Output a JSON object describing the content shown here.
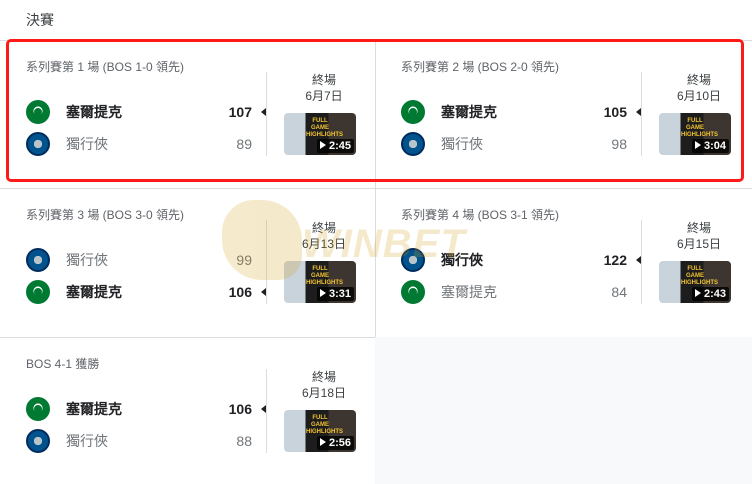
{
  "title": "決賽",
  "games": [
    {
      "header": "系列賽第 1 場 (BOS 1-0 領先)",
      "status": "終場",
      "date": "6月7日",
      "duration": "2:45",
      "thumb_banner": "FULL GAME HIGHLIGHTS",
      "teams": [
        {
          "name": "塞爾提克",
          "score": "107",
          "logo": "celtics-logo",
          "winner": true
        },
        {
          "name": "獨行俠",
          "score": "89",
          "logo": "mavericks-logo",
          "winner": false
        }
      ]
    },
    {
      "header": "系列賽第 2 場 (BOS 2-0 領先)",
      "status": "終場",
      "date": "6月10日",
      "duration": "3:04",
      "thumb_banner": "FULL GAME HIGHLIGHTS",
      "teams": [
        {
          "name": "塞爾提克",
          "score": "105",
          "logo": "celtics-logo",
          "winner": true
        },
        {
          "name": "獨行俠",
          "score": "98",
          "logo": "mavericks-logo",
          "winner": false
        }
      ]
    },
    {
      "header": "系列賽第 3 場 (BOS 3-0 領先)",
      "status": "終場",
      "date": "6月13日",
      "duration": "3:31",
      "thumb_banner": "FULL GAME HIGHLIGHTS",
      "teams": [
        {
          "name": "獨行俠",
          "score": "99",
          "logo": "mavericks-logo",
          "winner": false
        },
        {
          "name": "塞爾提克",
          "score": "106",
          "logo": "celtics-logo",
          "winner": true
        }
      ]
    },
    {
      "header": "系列賽第 4 場 (BOS 3-1 領先)",
      "status": "終場",
      "date": "6月15日",
      "duration": "2:43",
      "thumb_banner": "FULL GAME HIGHLIGHTS",
      "teams": [
        {
          "name": "獨行俠",
          "score": "122",
          "logo": "mavericks-logo",
          "winner": true
        },
        {
          "name": "塞爾提克",
          "score": "84",
          "logo": "celtics-logo",
          "winner": false
        }
      ]
    },
    {
      "header": "BOS 4-1 獲勝",
      "status": "終場",
      "date": "6月18日",
      "duration": "2:56",
      "thumb_banner": "FULL GAME HIGHLIGHTS",
      "teams": [
        {
          "name": "塞爾提克",
          "score": "106",
          "logo": "celtics-logo",
          "winner": true
        },
        {
          "name": "獨行俠",
          "score": "88",
          "logo": "mavericks-logo",
          "winner": false
        }
      ]
    }
  ],
  "watermark": "WINBET",
  "highlight_color": "#ff1a1a",
  "colors": {
    "celtics": "#007a33",
    "mavericks": "#00538c"
  }
}
